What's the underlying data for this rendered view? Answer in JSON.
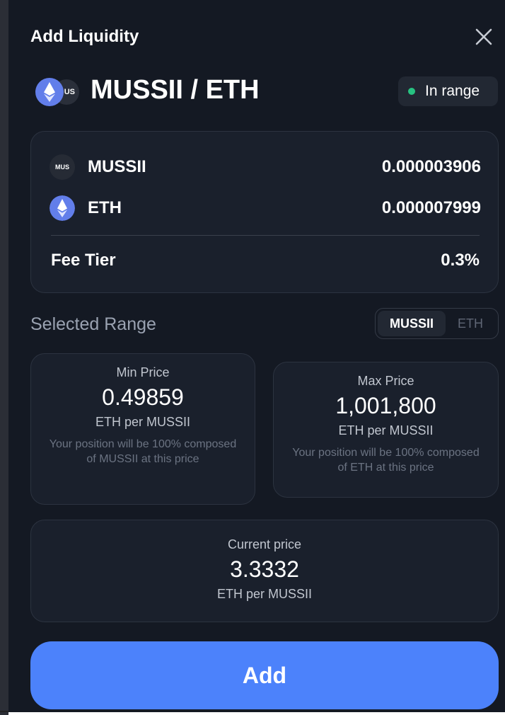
{
  "modal": {
    "title": "Add Liquidity",
    "close_icon": "close-icon"
  },
  "pair": {
    "name": "MUSSII / ETH",
    "back_icon_text": "US",
    "status": "In range",
    "status_color": "#27c281"
  },
  "tokens": [
    {
      "icon_text": "MUS",
      "name": "MUSSII",
      "amount": "0.000003906"
    },
    {
      "icon": "eth-icon",
      "name": "ETH",
      "amount": "0.000007999"
    }
  ],
  "fee": {
    "label": "Fee Tier",
    "value": "0.3%"
  },
  "range": {
    "title": "Selected Range",
    "toggle": {
      "selected": "MUSSII",
      "other": "ETH"
    },
    "min": {
      "label": "Min Price",
      "value": "0.49859",
      "unit": "ETH per MUSSII",
      "note": "Your position will be 100% composed of MUSSII at this price"
    },
    "max": {
      "label": "Max Price",
      "value": "1,001,800",
      "unit": "ETH per MUSSII",
      "note": "Your position will be 100% composed of ETH at this price"
    },
    "current": {
      "label": "Current price",
      "value": "3.3332",
      "unit": "ETH per MUSSII"
    }
  },
  "actions": {
    "add_label": "Add"
  },
  "colors": {
    "background": "#141923",
    "card": "#1a202c",
    "accent": "#4c82fb",
    "eth": "#627eea"
  }
}
